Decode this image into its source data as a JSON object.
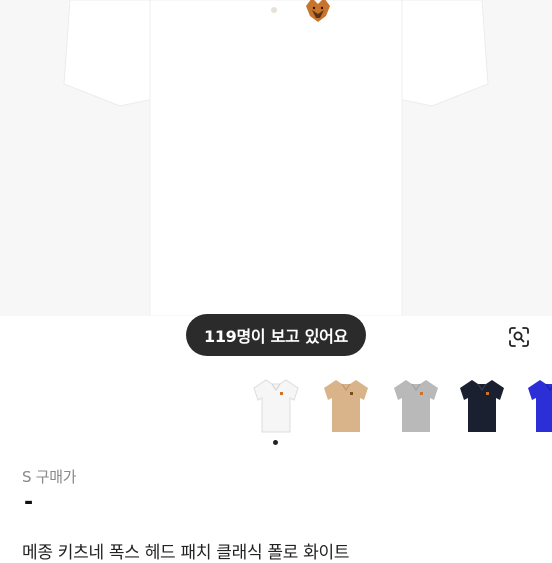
{
  "product": {
    "viewers_text": "119명이 보고 있어요",
    "price_label": "S 구매가",
    "price_value": "-",
    "title": "메종 키츠네 폭스 헤드 패치 클래식 폴로 화이트"
  },
  "icons": {
    "lens": "visual-search-icon",
    "patch": "fox-head-patch-icon"
  },
  "thumbnails": [
    {
      "color_name": "white",
      "color": "#f6f6f6"
    },
    {
      "color_name": "beige",
      "color": "#d9b48a"
    },
    {
      "color_name": "grey",
      "color": "#b9b9b9"
    },
    {
      "color_name": "navy",
      "color": "#1b2030"
    },
    {
      "color_name": "blue",
      "color": "#2d2fd6"
    }
  ],
  "selected_thumbnail": 0
}
